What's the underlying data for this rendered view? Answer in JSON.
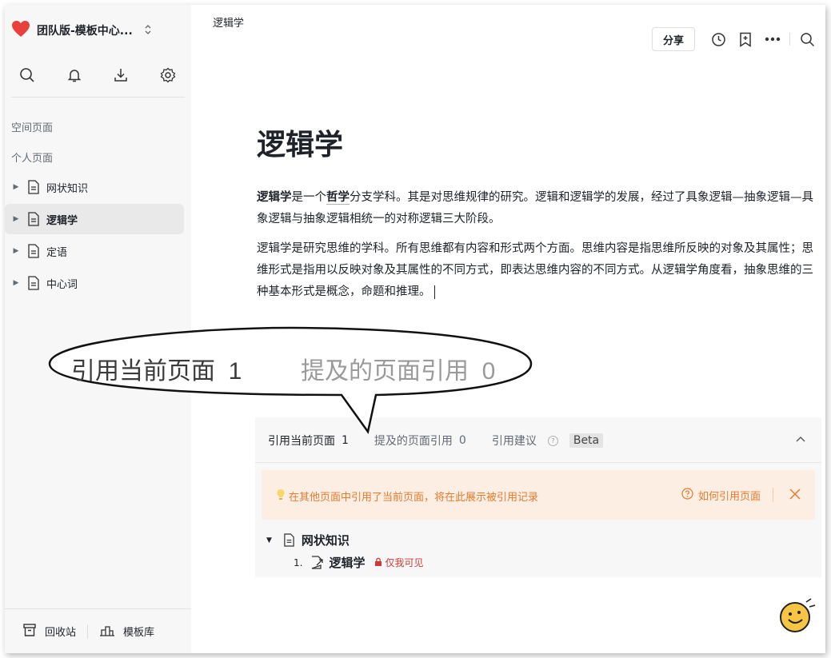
{
  "sidebar": {
    "workspace_name": "团队版-模板中心...",
    "sections": {
      "space": "空间页面",
      "personal": "个人页面"
    },
    "items": [
      {
        "label": "网状知识",
        "active": false
      },
      {
        "label": "逻辑学",
        "active": true
      },
      {
        "label": "定语",
        "active": false
      },
      {
        "label": "中心词",
        "active": false
      }
    ],
    "bottom": {
      "trash": "回收站",
      "templates": "模板库"
    }
  },
  "header": {
    "breadcrumb": "逻辑学",
    "share_label": "分享"
  },
  "doc": {
    "title": "逻辑学",
    "p1_bold": "逻辑学",
    "p1_mid": "是一个",
    "p1_link": "哲学",
    "p1_rest": "分支学科。其是对思维规律的研究。逻辑和逻辑学的发展，经过了具象逻辑—抽象逻辑—具象逻辑与抽象逻辑相统一的对称逻辑三大阶段。",
    "p2": "逻辑学是研究思维的学科。所有思维都有内容和形式两个方面。思维内容是指思维所反映的对象及其属性；思维形式是指用以反映对象及其属性的不同方式，即表达思维内容的不同方式。从逻辑学角度看，抽象思维的三种基本形式是概念，命题和推理。"
  },
  "backlinks": {
    "tab1_label": "引用当前页面",
    "tab1_count": "1",
    "tab2_label": "提及的页面引用",
    "tab2_count": "0",
    "tab3_label": "引用建议",
    "beta": "Beta",
    "notice": "在其他页面中引用了当前页面，将在此展示被引用记录",
    "notice_help": "如何引用页面",
    "group_title": "网状知识",
    "ref_num": "1.",
    "ref_title": "逻辑学",
    "ref_privacy": "仅我可见"
  },
  "callout": {
    "a_label": "引用当前页面",
    "a_count": "1",
    "b_label": "提及的页面引用",
    "b_count": "0"
  },
  "colors": {
    "accent_orange": "#e87a2b",
    "notice_bg": "#fdeee4",
    "private_red": "#d13a34",
    "heart": "#e8403b"
  }
}
